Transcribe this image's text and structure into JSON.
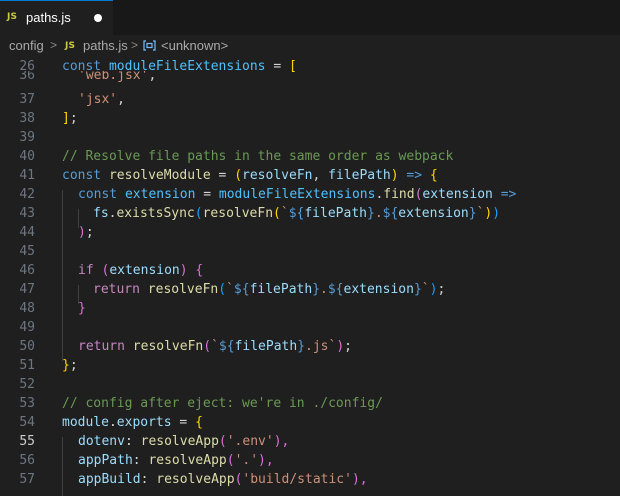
{
  "tab": {
    "icon": "JS",
    "label": "paths.js",
    "status": "unsaved-dot"
  },
  "breadcrumb": {
    "folder": "config",
    "separator": ">",
    "file_icon": "JS",
    "file": "paths.js",
    "symbol": "<unknown>"
  },
  "gutter": [
    "26",
    "36",
    "37",
    "38",
    "39",
    "40",
    "41",
    "42",
    "43",
    "44",
    "45",
    "46",
    "47",
    "48",
    "49",
    "50",
    "51",
    "52",
    "53",
    "54",
    "55",
    "56",
    "57"
  ],
  "active_line": "55",
  "code": {
    "l26": [
      "const",
      "moduleFileExtensions",
      " = ",
      "["
    ],
    "l36": [
      "'web.jsx'",
      ","
    ],
    "l37": [
      "'jsx'",
      ","
    ],
    "l38": [
      "]",
      ";"
    ],
    "l40": [
      "// Resolve file paths in the same order as webpack"
    ],
    "l41": [
      "const",
      "resolveModule",
      " = ",
      "(",
      "resolveFn",
      ", ",
      "filePath",
      ")",
      " => ",
      "{"
    ],
    "l42": [
      "const",
      "extension",
      " = ",
      "moduleFileExtensions",
      ".",
      "find",
      "(",
      "extension",
      " =>"
    ],
    "l43": [
      "fs",
      ".",
      "existsSync",
      "(",
      "resolveFn",
      "(",
      "`",
      "${",
      "filePath",
      "}",
      ".",
      "${",
      "extension",
      "}",
      "`",
      ")",
      ")"
    ],
    "l44": [
      ")",
      ";"
    ],
    "l46": [
      "if",
      " ",
      "(",
      "extension",
      ")",
      " ",
      "{"
    ],
    "l47": [
      "return",
      " ",
      "resolveFn",
      "(",
      "`",
      "${",
      "filePath",
      "}",
      ".",
      "${",
      "extension",
      "}",
      "`",
      ")",
      ";"
    ],
    "l48": [
      "}"
    ],
    "l50": [
      "return",
      " ",
      "resolveFn",
      "(",
      "`",
      "${",
      "filePath",
      "}",
      ".js",
      "`",
      ")",
      ";"
    ],
    "l51": [
      "}",
      ";"
    ],
    "l53": [
      "// config after eject: we're in ./config/"
    ],
    "l54": [
      "module",
      ".",
      "exports",
      " = ",
      "{"
    ],
    "l55": [
      "dotenv",
      ": ",
      "resolveApp",
      "(",
      "'.env'",
      "),"
    ],
    "l56": [
      "appPath",
      ": ",
      "resolveApp",
      "(",
      "'.'",
      "),"
    ],
    "l57": [
      "appBuild",
      ": ",
      "resolveApp",
      "(",
      "'build/static'",
      "),"
    ]
  },
  "colors": {
    "background": "#1f1f1f",
    "tab_accent": "#0078d4",
    "keyword": "#569cd6",
    "control": "#c586c0",
    "function": "#dcdcaa",
    "variable": "#9cdcfe",
    "string": "#ce9178",
    "comment": "#6a9955"
  }
}
